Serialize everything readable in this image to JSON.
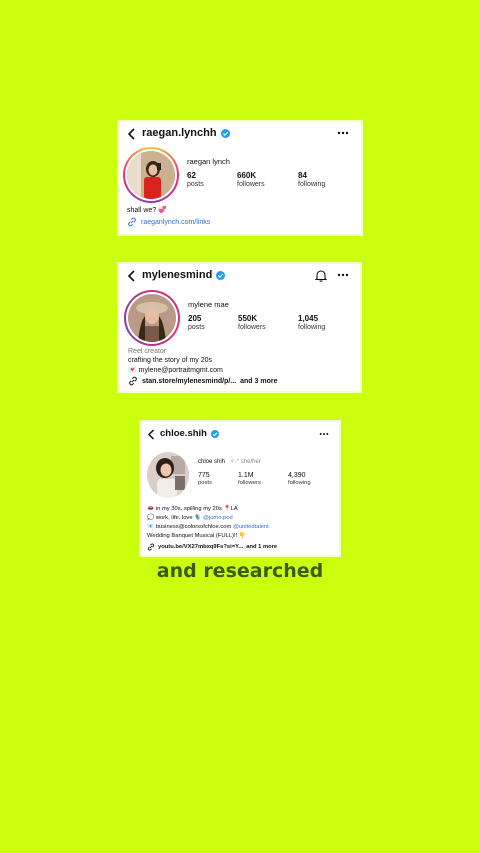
{
  "colors": {
    "background": "#ccff0d",
    "verified": "#1d9bf0",
    "link": "#2f6fd6",
    "headline": "#3d5a1a"
  },
  "profiles": [
    {
      "username": "raegan.lynchh",
      "display_name": "raegan lynch",
      "stats": [
        {
          "value": "62",
          "label": "posts"
        },
        {
          "value": "660K",
          "label": "followers"
        },
        {
          "value": "84",
          "label": "following"
        }
      ],
      "bio": [
        "shall we? 💞"
      ],
      "link_text": "raeganlynch.com/links",
      "icons": [
        "back-arrow-icon",
        "verified-icon",
        "more-icon",
        "link-icon"
      ]
    },
    {
      "username": "mylenesmind",
      "display_name": "mylene mae",
      "category": "Reel creator",
      "stats": [
        {
          "value": "205",
          "label": "posts"
        },
        {
          "value": "550K",
          "label": "followers"
        },
        {
          "value": "1,045",
          "label": "following"
        }
      ],
      "bio": [
        "crafting the story of my 20s",
        "💌 mylene@portraitmgmt.com"
      ],
      "link_text": "stan.store/mylenesmind/p/...",
      "link_more": "and 3 more",
      "icons": [
        "back-arrow-icon",
        "verified-icon",
        "bell-icon",
        "more-icon",
        "link-icon"
      ]
    },
    {
      "username": "chloe.shih",
      "display_name": "chloe shih",
      "pronoun_badge": "✧˖° she/her",
      "stats": [
        {
          "value": "775",
          "label": "posts"
        },
        {
          "value": "1.1M",
          "label": "followers"
        },
        {
          "value": "4,390",
          "label": "following"
        }
      ],
      "bio": [
        "👄 in my 30s, spilling my 20s 📍LA",
        "💭 work, life, love 🎙️",
        "📧 business@colorsofchloe.com",
        "Wedding Banquet Musical (FULL)!! 👇"
      ],
      "bio_mentions": [
        "@jomo.pod",
        "@unitedtalent"
      ],
      "link_text": "youtu.be/VX27mbxq9Fs?si=Y...",
      "link_more": "and 1 more",
      "icons": [
        "back-arrow-icon",
        "verified-icon",
        "more-icon",
        "link-icon"
      ]
    }
  ],
  "headline": "and researched"
}
